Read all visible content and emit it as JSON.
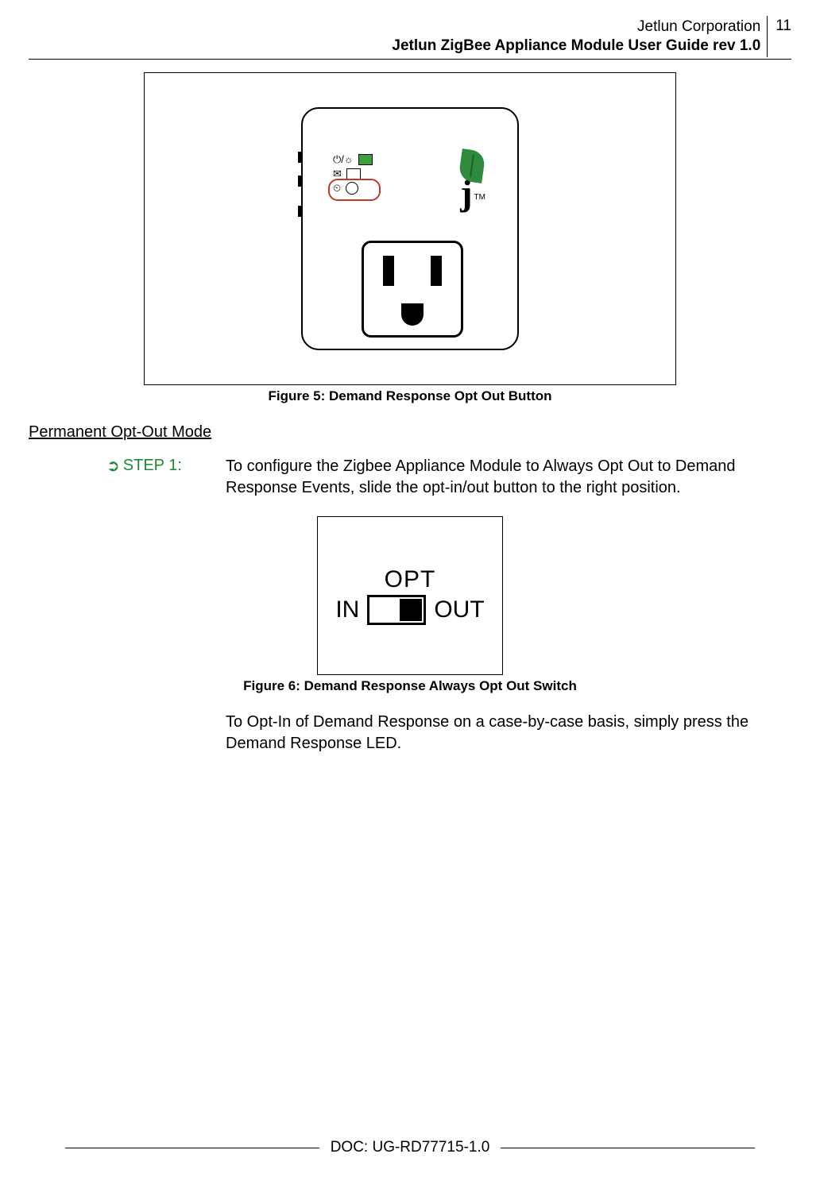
{
  "header": {
    "company": "Jetlun Corporation",
    "title": "Jetlun ZigBee Appliance Module User Guide rev 1.0",
    "page_number": "11"
  },
  "figure5": {
    "caption": "Figure 5: Demand Response Opt Out Button",
    "indicators": {
      "power": "⏻/☼",
      "message": "✉",
      "demand": "⏲"
    },
    "trademark": "TM"
  },
  "section": {
    "heading": "Permanent Opt-Out Mode"
  },
  "step1": {
    "label": "STEP 1:",
    "arrow": "➲",
    "text": "To configure the Zigbee Appliance Module to Always Opt Out to Demand Response Events, slide the opt-in/out button to the right position."
  },
  "figure6": {
    "caption": "Figure 6: Demand Response Always Opt Out Switch",
    "label_top": "OPT",
    "label_left": "IN",
    "label_right": "OUT"
  },
  "paragraph2": "To Opt-In of Demand Response on a case-by-case basis, simply press the Demand Response LED.",
  "footer": {
    "doc": "DOC: UG-RD77715-1.0"
  }
}
